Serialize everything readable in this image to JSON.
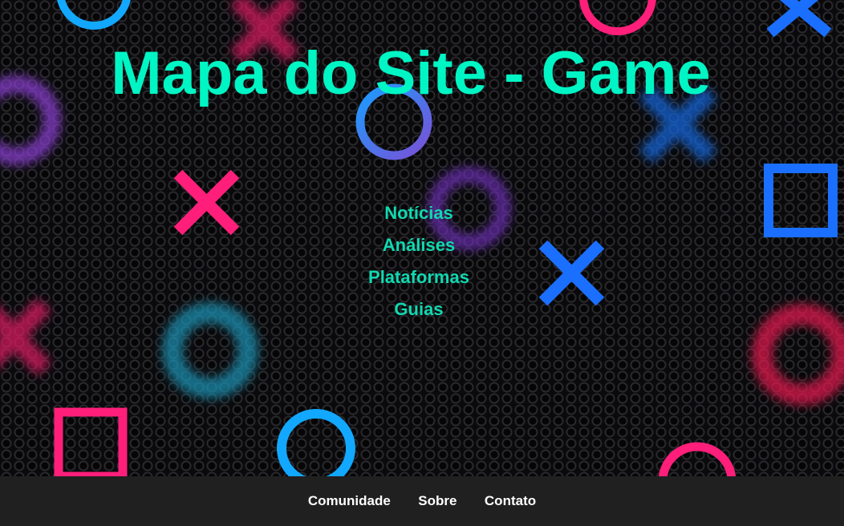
{
  "page": {
    "title": "Mapa do Site - Game"
  },
  "sitemap": {
    "links": [
      {
        "label": "Notícias"
      },
      {
        "label": "Análises"
      },
      {
        "label": "Plataformas"
      },
      {
        "label": "Guias"
      }
    ]
  },
  "footer": {
    "links": [
      {
        "label": "Comunidade"
      },
      {
        "label": "Sobre"
      },
      {
        "label": "Contato"
      }
    ]
  },
  "colors": {
    "title": "#00f5c4",
    "link": "#10d9b0",
    "footer_bg": "#202020",
    "footer_text": "#ffffff",
    "shape_pink": "#ff1f7a",
    "shape_blue": "#1a6fff",
    "shape_cyan": "#12a8ff",
    "shape_purple": "#8a3fd1"
  },
  "background_icons": [
    "circle-icon",
    "cross-icon",
    "square-icon"
  ]
}
